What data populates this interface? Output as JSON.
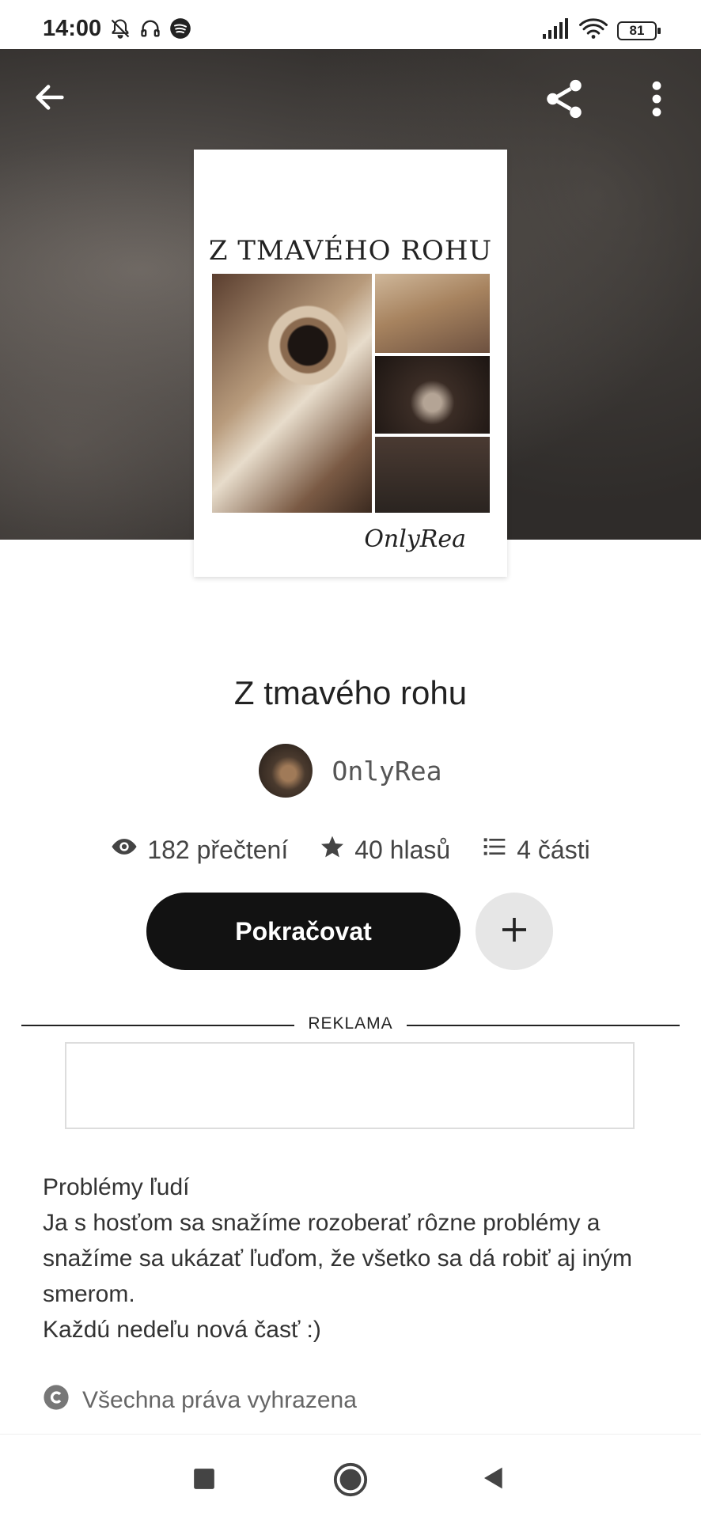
{
  "status_bar": {
    "time": "14:00",
    "battery": "81"
  },
  "icons": {
    "back": "arrow-left-icon",
    "share": "share-icon",
    "more": "more-vert-icon",
    "views": "eye-icon",
    "votes": "star-icon",
    "parts": "list-icon",
    "add": "plus-icon",
    "copyright": "copyright-icon"
  },
  "cover": {
    "title": "Z TMAVÉHO ROHU",
    "signature": "OnlyRea"
  },
  "story": {
    "title": "Z tmavého rohu",
    "author": "OnlyRea",
    "reads": "182 přečtení",
    "votes": "40 hlasů",
    "parts": "4 části"
  },
  "actions": {
    "continue_label": "Pokračovat"
  },
  "ad": {
    "label": "REKLAMA"
  },
  "description": {
    "lines": [
      "Problémy ľudí",
      "Ja s hosťom sa snažíme rozoberať rôzne problémy a",
      "snažíme sa ukázať ľuďom, že všetko sa dá robiť aj iným",
      "smerom.",
      "Každú nedeľu nová časť :)"
    ]
  },
  "rights": {
    "label": "Všechna práva vyhrazena"
  },
  "colors": {
    "primary_button": "#121212",
    "secondary_button": "#e6e6e6"
  }
}
